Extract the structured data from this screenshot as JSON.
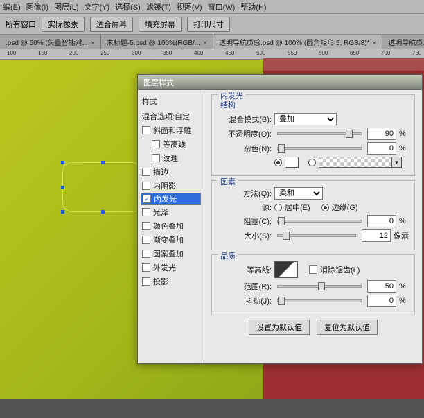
{
  "menu": [
    "編(E)",
    "图像(I)",
    "图层(L)",
    "文字(Y)",
    "选择(S)",
    "滤镜(T)",
    "视图(V)",
    "窗口(W)",
    "帮助(H)"
  ],
  "toolbar": {
    "b0": "所有窗口",
    "b1": "实际像素",
    "b2": "适合屏幕",
    "b3": "填充屏幕",
    "b4": "打印尺寸"
  },
  "tabs": {
    "t1": ".psd @ 50% (矢量智能对...",
    "t2": "未标题-5.psd @ 100%(RGB/...",
    "t3": "透明导航质感.psd @ 100% (圆角矩形 5, RGB/8)*",
    "t4": "透明导航质..."
  },
  "ruler": [
    "100",
    "150",
    "200",
    "250",
    "300",
    "350",
    "400",
    "450",
    "500",
    "550",
    "600",
    "650",
    "700",
    "750"
  ],
  "dialog": {
    "title": "图层样式",
    "styles_hdr": "样式",
    "blend_opts": "混合选项:自定",
    "items": {
      "bevel": "斜面和浮雕",
      "contour": "等高线",
      "texture": "纹理",
      "stroke": "描边",
      "inner_shadow": "内阴影",
      "inner_glow": "内发光",
      "satin": "光泽",
      "color_overlay": "颜色叠加",
      "grad_overlay": "渐变叠加",
      "pattern_overlay": "图案叠加",
      "outer_glow": "外发光",
      "drop_shadow": "投影"
    },
    "panel_title": "内发光",
    "grp_struct": "结构",
    "grp_elem": "图素",
    "grp_qual": "品质",
    "labels": {
      "blend_mode": "混合模式(B):",
      "opacity": "不透明度(O):",
      "noise": "杂色(N):",
      "method": "方法(Q):",
      "source": "源:",
      "center": "居中(E)",
      "edge": "边缘(G)",
      "choke": "阻塞(C):",
      "size": "大小(S):",
      "contour": "等高线:",
      "anti": "消除锯齿(L)",
      "range": "范围(R):",
      "jitter": "抖动(J):"
    },
    "values": {
      "blend_mode": "叠加",
      "opacity": "90",
      "noise": "0",
      "method": "柔和",
      "choke": "0",
      "size": "12",
      "range": "50",
      "jitter": "0"
    },
    "units": {
      "pct": "%",
      "px": "像素"
    },
    "btns": {
      "default": "设置为默认值",
      "reset": "复位为默认值"
    }
  }
}
